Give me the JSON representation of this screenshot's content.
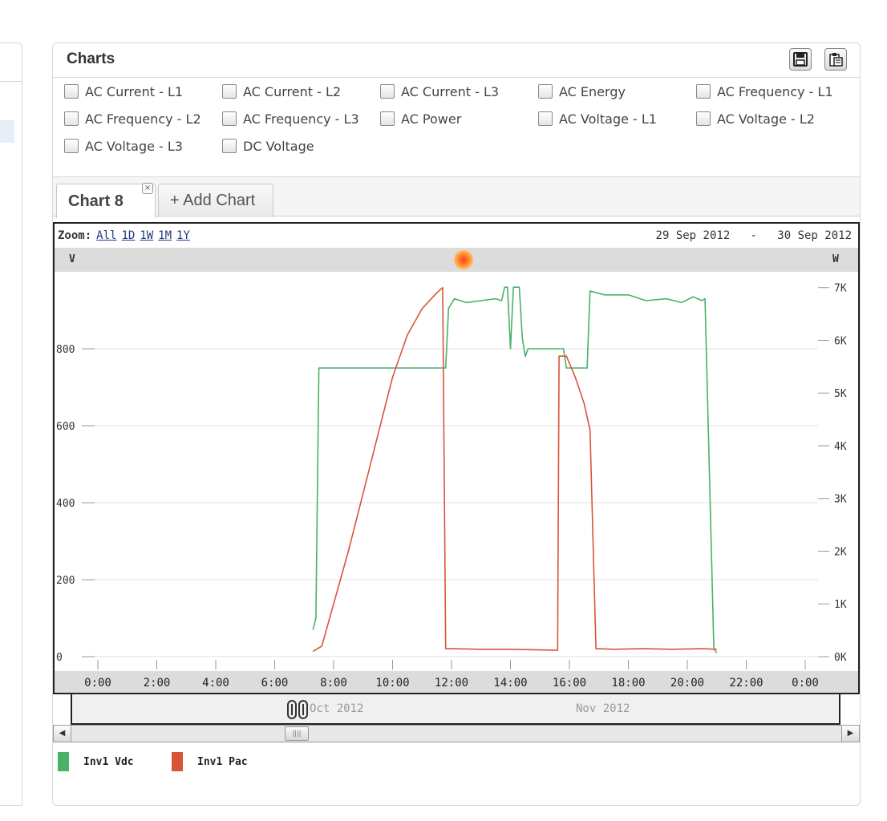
{
  "panel": {
    "title": "Charts",
    "save_icon": "floppy-disk-icon",
    "export_icon": "clipboard-icon"
  },
  "options": [
    "AC Current - L1",
    "AC Current - L2",
    "AC Current - L3",
    "AC Energy",
    "AC Frequency - L1",
    "AC Frequency - L2",
    "AC Frequency - L3",
    "AC Power",
    "AC Voltage - L1",
    "AC Voltage - L2",
    "AC Voltage - L3",
    "DC Voltage"
  ],
  "tabs": {
    "active_label": "Chart 8",
    "close_glyph": "×",
    "add_label": "+ Add Chart"
  },
  "zoom": {
    "label": "Zoom:",
    "options": [
      "All",
      "1D",
      "1W",
      "1M",
      "1Y"
    ]
  },
  "date_range": {
    "from": "29 Sep 2012",
    "separator": "-",
    "to": "30 Sep 2012"
  },
  "units": {
    "left": "V",
    "right": "W"
  },
  "navigator": {
    "labels": [
      "Oct 2012",
      "Nov 2012"
    ]
  },
  "colors": {
    "vdc": "#4caf6a",
    "pac": "#d9533a"
  },
  "chart_data": {
    "type": "line",
    "x_ticks": [
      "0:00",
      "2:00",
      "4:00",
      "6:00",
      "8:00",
      "10:00",
      "12:00",
      "14:00",
      "16:00",
      "18:00",
      "20:00",
      "22:00",
      "0:00"
    ],
    "y_left": {
      "unit": "V",
      "ticks": [
        "0",
        "200",
        "400",
        "600",
        "800"
      ],
      "ylim": [
        0,
        1000
      ]
    },
    "y_right": {
      "unit": "W",
      "ticks": [
        "0K",
        "1K",
        "2K",
        "3K",
        "4K",
        "5K",
        "6K",
        "7K"
      ],
      "ylim": [
        0,
        7300
      ]
    },
    "grid": true,
    "legend_placement": "bottom-left",
    "series": [
      {
        "name": "Inv1 Vdc",
        "axis": "left",
        "color": "#4caf6a",
        "points": [
          [
            7.3,
            70
          ],
          [
            7.4,
            100
          ],
          [
            7.5,
            750
          ],
          [
            11.8,
            750
          ],
          [
            11.9,
            905
          ],
          [
            12.1,
            930
          ],
          [
            12.5,
            920
          ],
          [
            13.0,
            925
          ],
          [
            13.5,
            930
          ],
          [
            13.7,
            925
          ],
          [
            13.8,
            960
          ],
          [
            13.9,
            960
          ],
          [
            14.0,
            800
          ],
          [
            14.1,
            960
          ],
          [
            14.3,
            960
          ],
          [
            14.4,
            830
          ],
          [
            14.5,
            780
          ],
          [
            14.6,
            800
          ],
          [
            15.8,
            800
          ],
          [
            15.9,
            750
          ],
          [
            16.6,
            750
          ],
          [
            16.7,
            950
          ],
          [
            17.2,
            940
          ],
          [
            18.0,
            940
          ],
          [
            18.6,
            925
          ],
          [
            19.3,
            930
          ],
          [
            19.8,
            920
          ],
          [
            20.2,
            935
          ],
          [
            20.5,
            925
          ],
          [
            20.6,
            930
          ],
          [
            20.9,
            20
          ],
          [
            21.0,
            10
          ]
        ]
      },
      {
        "name": "Inv1 Pac",
        "axis": "right",
        "color": "#d9533a",
        "points": [
          [
            7.3,
            100
          ],
          [
            7.6,
            200
          ],
          [
            8.0,
            1000
          ],
          [
            8.5,
            2000
          ],
          [
            9.0,
            3100
          ],
          [
            9.5,
            4200
          ],
          [
            10.0,
            5300
          ],
          [
            10.5,
            6100
          ],
          [
            11.0,
            6600
          ],
          [
            11.5,
            6900
          ],
          [
            11.7,
            7000
          ],
          [
            11.8,
            150
          ],
          [
            12.0,
            150
          ],
          [
            13.0,
            140
          ],
          [
            14.0,
            140
          ],
          [
            15.6,
            120
          ],
          [
            15.65,
            5700
          ],
          [
            15.9,
            5700
          ],
          [
            16.2,
            5300
          ],
          [
            16.5,
            4800
          ],
          [
            16.7,
            4300
          ],
          [
            16.9,
            150
          ],
          [
            17.5,
            140
          ],
          [
            18.5,
            150
          ],
          [
            19.5,
            140
          ],
          [
            20.5,
            150
          ],
          [
            21.0,
            140
          ]
        ]
      }
    ]
  }
}
